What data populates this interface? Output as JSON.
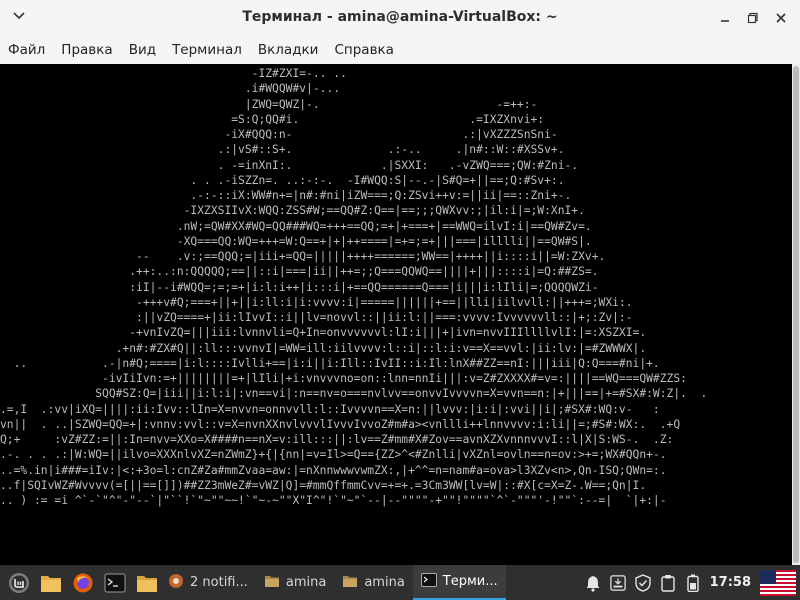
{
  "window": {
    "title": "Терминал - amina@amina-VirtualBox: ~",
    "buttons": {
      "minimize": "‒",
      "maximize": "❐",
      "close": "✕"
    },
    "left_icon": "chevron-down-icon"
  },
  "menubar": {
    "items": [
      "Файл",
      "Правка",
      "Вид",
      "Терминал",
      "Вкладки",
      "Справка"
    ]
  },
  "terminal": {
    "bg": "#000000",
    "fg": "#bdbdbd",
    "lines": [
      "                                     -IZ#ZXI=-.. ..",
      "                                    .i#WQQW#v|-...",
      "                                    |ZWQ=QWZ|-.                          -=++:-",
      "                                  =S:Q;QQ#i.                         .=IXZXnvi+:",
      "                                 -iX#QQQ:n-                         .:|vXZZZSnSni-",
      "                                .:|vS#::S+.              .:-..     .|n#::W::#XSSv+.",
      "                                . -=inXnI:.             .|SXXI:   .-vZWQ===;QW:#Zni-.",
      "                            . . .-iSZZn=. ..:-:-.  -I#WQQ:S|--.-|S#Q=+||==;Q:#Sv+:.",
      "                            .-:-::iX:WW#n+=|n#:#ni|iZW===;Q:ZSvi++v:=||ii|==::Zni+-.",
      "                           -IXZXSIIvX:WQQ:ZSS#W;==QQ#Z:Q==|==;;;QWXvv:;|il:i|=;W:XnI+.",
      "                          .nW;=QW#XX#WQ=QQ###WQ=+++==QQ;=+|+===+|==WWQ=ilvI:i|==QW#Zv=.",
      "                          -XQ===QQ:WQ=+++=W:Q==+|+|++====|=+=;=+|||===|illlli||==QW#S|.",
      "                    --    .v:;==QQQ;=|iii+=QQ=|||||++++======;WW==|++++||i::::i||=W:ZXv+.",
      "                   .++:..:n:QQQQQ;==||::i|===|ii||++=;;Q===QQWQ==||||+|||::::i|=Q:##ZS=.",
      "                   :iI|--i#WQQ=;=;=+|i:l:i++|i:::i|+==QQ======Q===|i|||i:lIli|=;QQQQWZi-",
      "                    -+++v#Q;===+||+||i:ll:i|i:vvvv:i|=====||||||+==||lli|iilvvll:||+++=;WXi:.",
      "                    :||vZQ====+|ii:lIvvI::i||lv=novvl::||ii:l:||===:vvvv:Ivvvvvvll::|+;:Zv|:-",
      "                   -+vnIvZQ=|||iii:lvnnvli=Q+In=onvvvvvvl:lI:i|||+|ivn=nvvIIIllllvlI:|=:XSZXI=.",
      "                 .+n#:#ZX#Q||:ll:::vvnvI|=WW=ill:iilvvvv:l::i|::l:i:v==X==vvl:|ii:lv:|=#ZWWWX|.",
      "  ..           .-|n#Q;====|i:l::::Ivlli+==|i:i||i:Ill::IvII::i:Il:lnX##ZZ==nI:|||iii|Q:Q===#ni|+.",
      "               -ivIiIvn:=+||||||||=+|lIli|+i:vnvvvno=on::lnn=nnIi|||:v=Z#ZXXXX#=v=:||||==WQ===QW#ZZS:",
      "              SQQ#SZ:Q=|iii||i:l:i|:vn==vi|:n==nv=o===nvlvv==onvvIvvvvn=X=vvn==n:|+|||==|+=#SX#:W:Z|.  .",
      ".=,I  .:vv|iXQ=||||:ii:Ivv::lIn=X=nvvn=onnvvll:l::Ivvvvn==X=n:||lvvv:|i:i|:vvi||i|;#SX#:WQ:v-   :",
      "vn||  . ..|SZWQ=QQ=+|:vnnv:vvl::v=X=nvnXXnvlvvvlIvvvIvvoZ#m#a><vnllli++lnnvvvv:i:li||=;#S#:WX:.  .+Q",
      "Q;+     :vZ#ZZ:=||:In=nvv=XXo=X####n==nX=v:ill:::||:lv==Z#mm#X#Zov==avnXZXvnnnvvvI::l|X|S:WS-.  .Z:",
      ".-. . . .:|W:WQ=||ilvo=XXXnlvXZ=nZWmZ}+{|{nn|=v=Il>=Q=={ZZ>^<#Znlli|vXZnl=ovln==n=ov:>+=;WX#QQn+-.",
      "..=%.in|i###=iIv:|<:+3o=l:cnZ#Za#mmZvaa=aw:|=nXnnwwwvwmZX:,|+^^=n=nam#a=ova>l3XZv<n>,Qn-ISQ;QWn=:.",
      "..f|SQIvWZ#Wvvvv(=[||==[]])##ZZ3mWeZ#=vWZ|Q]=#mmQffmmCvv=+=+.=3Cm3WW[lv=W|::#X[c=X=Z-.W==;Qn|I.",
      ".. ) := =i ^`-`\"^\"-\"--`|\"``!`\"~\"\"~~!`\"~-~\"\"X\"I^\"!`\"~\"`--|--\"\"\"\"-+\"\"!\"\"\"\"`^`-\"\"\"'-!\"\"`:--=|  `|+:|-"
    ]
  },
  "taskbar": {
    "bg": "#2f2f2f",
    "launchers": [
      {
        "name": "mint-menu-icon"
      },
      {
        "name": "files-icon"
      },
      {
        "name": "firefox-icon"
      },
      {
        "name": "terminal-launcher-icon"
      },
      {
        "name": "folder-icon"
      }
    ],
    "tasks": [
      {
        "label": "2 notifi...",
        "icon": "notification-icon",
        "active": false
      },
      {
        "label": "amina",
        "icon": "folder-icon",
        "active": false
      },
      {
        "label": "amina",
        "icon": "folder-icon",
        "active": false
      },
      {
        "label": "Терми...",
        "icon": "terminal-icon",
        "active": true
      }
    ],
    "tray": {
      "icons": [
        "bell-icon",
        "network-icon",
        "shield-icon",
        "clipboard-icon",
        "battery-icon"
      ],
      "clock": "17:58",
      "accent": "#35a4dc"
    }
  }
}
